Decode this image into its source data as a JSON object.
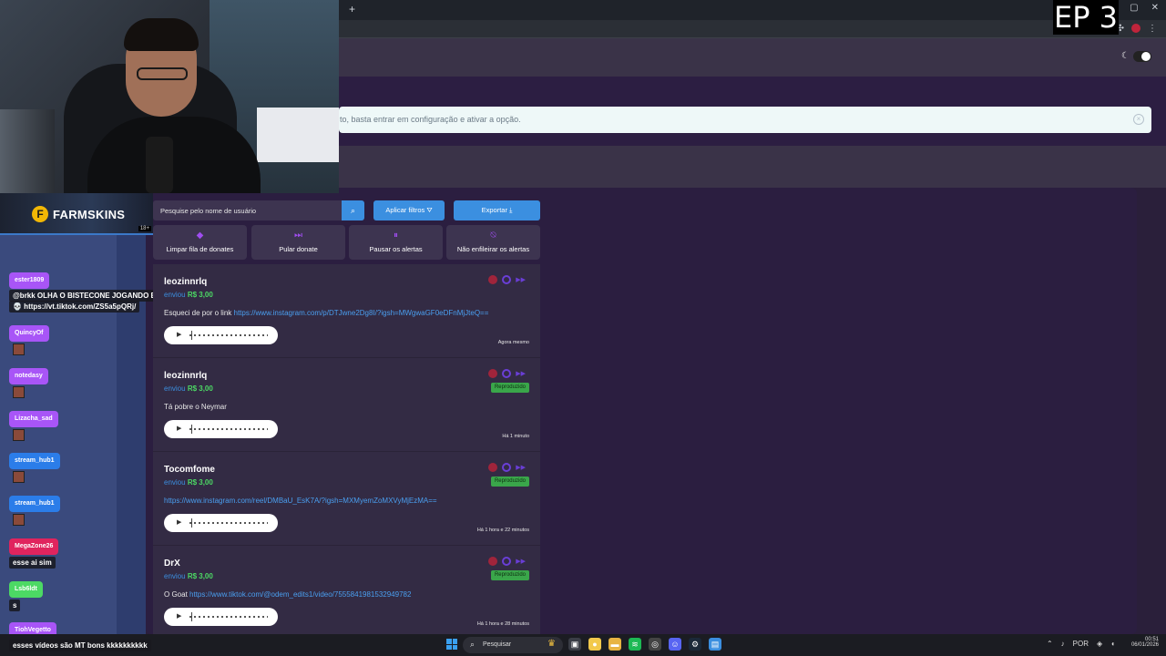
{
  "browser": {
    "new_tab": "+",
    "window_controls": [
      "—",
      "▢",
      "✕"
    ]
  },
  "overlay": {
    "episode": "EP 3",
    "sponsor": "FARMSKINS",
    "sponsor_age": "18+"
  },
  "banner": {
    "text": "to, basta entrar em configuração e ativar a opção."
  },
  "toolbar": {
    "search_placeholder": "Pesquise pelo nome de usuário",
    "search_icon": "search-icon",
    "filter_label": "Aplicar filtros",
    "export_label": "Exportar"
  },
  "actions": [
    {
      "label": "Limpar fila de donates",
      "icon": "eraser-icon"
    },
    {
      "label": "Pular donate",
      "icon": "skip-icon"
    },
    {
      "label": "Pausar os alertas",
      "icon": "pause-icon"
    },
    {
      "label": "Não enfileirar os alertas",
      "icon": "bell-off-icon"
    }
  ],
  "donations": [
    {
      "user": "leozinnrlq",
      "sent": "enviou",
      "amount": "R$ 3,00",
      "text": "Esqueci de por o link",
      "link": "https://www.instagram.com/p/DTJwne2Dg8I/?igsh=MWgwaGF0eDFnMjJteQ==",
      "time": "Agora mesmo",
      "badge": ""
    },
    {
      "user": "leozinnrlq",
      "sent": "enviou",
      "amount": "R$ 3,00",
      "text": "Tá pobre o Neymar",
      "link": "",
      "time": "Há 1 minuto",
      "badge": "Reproduzido"
    },
    {
      "user": "Tocomfome",
      "sent": "enviou",
      "amount": "R$ 3,00",
      "text": "",
      "link": "https://www.instagram.com/reel/DMBaU_EsK7A/?igsh=MXMyemZoMXVyMjEzMA==",
      "time": "Há 1 hora e 22 minutos",
      "badge": "Reproduzido"
    },
    {
      "user": "DrX",
      "sent": "enviou",
      "amount": "R$ 3,00",
      "text": "O Goat",
      "link": "https://www.tiktok.com/@odem_edits1/video/7555841981532949782",
      "time": "Há 1 hora e 28 minutos",
      "badge": "Reproduzido"
    }
  ],
  "chat": {
    "users": [
      {
        "name": "ester1809",
        "color": "#a855f7"
      },
      {
        "name": "QuincyOf",
        "color": "#a855f7"
      },
      {
        "name": "notedasy",
        "color": "#a855f7"
      },
      {
        "name": "Lizacha_sad",
        "color": "#a855f7"
      },
      {
        "name": "stream_hub1",
        "color": "#2b7de9"
      },
      {
        "name": "stream_hub1",
        "color": "#2b7de9"
      },
      {
        "name": "MegaZone26",
        "color": "#e0245e"
      },
      {
        "name": "Lsb6ldt",
        "color": "#4cd964"
      },
      {
        "name": "TiohVegetto",
        "color": "#a855f7"
      }
    ],
    "messages": {
      "m1": "@brkk OLHA O BISTECONE JOGANDO ESSE JOGO 💀",
      "m1b": "💀 https://vt.tiktok.com/ZS5a5pQRj/",
      "m2": "esse ai sim",
      "m3": "s",
      "m4": "esses vídeos são MT bons kkkkkkkkkk"
    }
  },
  "taskbar": {
    "search": "Pesquisar",
    "lang": "POR",
    "time": "00:51",
    "date": "06/01/2026"
  }
}
